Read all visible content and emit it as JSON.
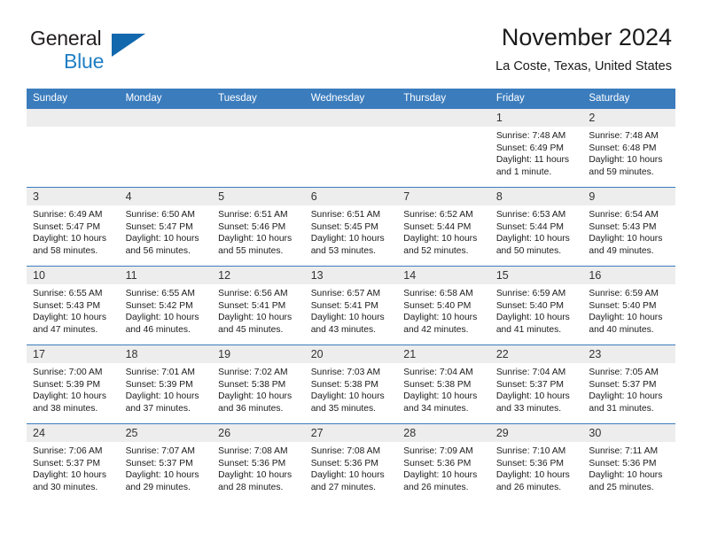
{
  "brand": {
    "name_part1": "General",
    "name_part2": "Blue",
    "logo_icon": "triangle-logo-icon"
  },
  "header": {
    "title": "November 2024",
    "location": "La Coste, Texas, United States"
  },
  "calendar": {
    "weekday_headers": [
      "Sunday",
      "Monday",
      "Tuesday",
      "Wednesday",
      "Thursday",
      "Friday",
      "Saturday"
    ],
    "colors": {
      "header_blue": "#3b7cbd",
      "daynum_gray": "#ededed",
      "brand_blue": "#1f7fc4",
      "logo_blue": "#1268ad",
      "text": "#1b1b1b"
    },
    "weeks": [
      [
        {
          "day": "",
          "sunrise": "",
          "sunset": "",
          "daylight": "",
          "daylight2": ""
        },
        {
          "day": "",
          "sunrise": "",
          "sunset": "",
          "daylight": "",
          "daylight2": ""
        },
        {
          "day": "",
          "sunrise": "",
          "sunset": "",
          "daylight": "",
          "daylight2": ""
        },
        {
          "day": "",
          "sunrise": "",
          "sunset": "",
          "daylight": "",
          "daylight2": ""
        },
        {
          "day": "",
          "sunrise": "",
          "sunset": "",
          "daylight": "",
          "daylight2": ""
        },
        {
          "day": "1",
          "sunrise": "Sunrise: 7:48 AM",
          "sunset": "Sunset: 6:49 PM",
          "daylight": "Daylight: 11 hours",
          "daylight2": "and 1 minute."
        },
        {
          "day": "2",
          "sunrise": "Sunrise: 7:48 AM",
          "sunset": "Sunset: 6:48 PM",
          "daylight": "Daylight: 10 hours",
          "daylight2": "and 59 minutes."
        }
      ],
      [
        {
          "day": "3",
          "sunrise": "Sunrise: 6:49 AM",
          "sunset": "Sunset: 5:47 PM",
          "daylight": "Daylight: 10 hours",
          "daylight2": "and 58 minutes."
        },
        {
          "day": "4",
          "sunrise": "Sunrise: 6:50 AM",
          "sunset": "Sunset: 5:47 PM",
          "daylight": "Daylight: 10 hours",
          "daylight2": "and 56 minutes."
        },
        {
          "day": "5",
          "sunrise": "Sunrise: 6:51 AM",
          "sunset": "Sunset: 5:46 PM",
          "daylight": "Daylight: 10 hours",
          "daylight2": "and 55 minutes."
        },
        {
          "day": "6",
          "sunrise": "Sunrise: 6:51 AM",
          "sunset": "Sunset: 5:45 PM",
          "daylight": "Daylight: 10 hours",
          "daylight2": "and 53 minutes."
        },
        {
          "day": "7",
          "sunrise": "Sunrise: 6:52 AM",
          "sunset": "Sunset: 5:44 PM",
          "daylight": "Daylight: 10 hours",
          "daylight2": "and 52 minutes."
        },
        {
          "day": "8",
          "sunrise": "Sunrise: 6:53 AM",
          "sunset": "Sunset: 5:44 PM",
          "daylight": "Daylight: 10 hours",
          "daylight2": "and 50 minutes."
        },
        {
          "day": "9",
          "sunrise": "Sunrise: 6:54 AM",
          "sunset": "Sunset: 5:43 PM",
          "daylight": "Daylight: 10 hours",
          "daylight2": "and 49 minutes."
        }
      ],
      [
        {
          "day": "10",
          "sunrise": "Sunrise: 6:55 AM",
          "sunset": "Sunset: 5:43 PM",
          "daylight": "Daylight: 10 hours",
          "daylight2": "and 47 minutes."
        },
        {
          "day": "11",
          "sunrise": "Sunrise: 6:55 AM",
          "sunset": "Sunset: 5:42 PM",
          "daylight": "Daylight: 10 hours",
          "daylight2": "and 46 minutes."
        },
        {
          "day": "12",
          "sunrise": "Sunrise: 6:56 AM",
          "sunset": "Sunset: 5:41 PM",
          "daylight": "Daylight: 10 hours",
          "daylight2": "and 45 minutes."
        },
        {
          "day": "13",
          "sunrise": "Sunrise: 6:57 AM",
          "sunset": "Sunset: 5:41 PM",
          "daylight": "Daylight: 10 hours",
          "daylight2": "and 43 minutes."
        },
        {
          "day": "14",
          "sunrise": "Sunrise: 6:58 AM",
          "sunset": "Sunset: 5:40 PM",
          "daylight": "Daylight: 10 hours",
          "daylight2": "and 42 minutes."
        },
        {
          "day": "15",
          "sunrise": "Sunrise: 6:59 AM",
          "sunset": "Sunset: 5:40 PM",
          "daylight": "Daylight: 10 hours",
          "daylight2": "and 41 minutes."
        },
        {
          "day": "16",
          "sunrise": "Sunrise: 6:59 AM",
          "sunset": "Sunset: 5:40 PM",
          "daylight": "Daylight: 10 hours",
          "daylight2": "and 40 minutes."
        }
      ],
      [
        {
          "day": "17",
          "sunrise": "Sunrise: 7:00 AM",
          "sunset": "Sunset: 5:39 PM",
          "daylight": "Daylight: 10 hours",
          "daylight2": "and 38 minutes."
        },
        {
          "day": "18",
          "sunrise": "Sunrise: 7:01 AM",
          "sunset": "Sunset: 5:39 PM",
          "daylight": "Daylight: 10 hours",
          "daylight2": "and 37 minutes."
        },
        {
          "day": "19",
          "sunrise": "Sunrise: 7:02 AM",
          "sunset": "Sunset: 5:38 PM",
          "daylight": "Daylight: 10 hours",
          "daylight2": "and 36 minutes."
        },
        {
          "day": "20",
          "sunrise": "Sunrise: 7:03 AM",
          "sunset": "Sunset: 5:38 PM",
          "daylight": "Daylight: 10 hours",
          "daylight2": "and 35 minutes."
        },
        {
          "day": "21",
          "sunrise": "Sunrise: 7:04 AM",
          "sunset": "Sunset: 5:38 PM",
          "daylight": "Daylight: 10 hours",
          "daylight2": "and 34 minutes."
        },
        {
          "day": "22",
          "sunrise": "Sunrise: 7:04 AM",
          "sunset": "Sunset: 5:37 PM",
          "daylight": "Daylight: 10 hours",
          "daylight2": "and 33 minutes."
        },
        {
          "day": "23",
          "sunrise": "Sunrise: 7:05 AM",
          "sunset": "Sunset: 5:37 PM",
          "daylight": "Daylight: 10 hours",
          "daylight2": "and 31 minutes."
        }
      ],
      [
        {
          "day": "24",
          "sunrise": "Sunrise: 7:06 AM",
          "sunset": "Sunset: 5:37 PM",
          "daylight": "Daylight: 10 hours",
          "daylight2": "and 30 minutes."
        },
        {
          "day": "25",
          "sunrise": "Sunrise: 7:07 AM",
          "sunset": "Sunset: 5:37 PM",
          "daylight": "Daylight: 10 hours",
          "daylight2": "and 29 minutes."
        },
        {
          "day": "26",
          "sunrise": "Sunrise: 7:08 AM",
          "sunset": "Sunset: 5:36 PM",
          "daylight": "Daylight: 10 hours",
          "daylight2": "and 28 minutes."
        },
        {
          "day": "27",
          "sunrise": "Sunrise: 7:08 AM",
          "sunset": "Sunset: 5:36 PM",
          "daylight": "Daylight: 10 hours",
          "daylight2": "and 27 minutes."
        },
        {
          "day": "28",
          "sunrise": "Sunrise: 7:09 AM",
          "sunset": "Sunset: 5:36 PM",
          "daylight": "Daylight: 10 hours",
          "daylight2": "and 26 minutes."
        },
        {
          "day": "29",
          "sunrise": "Sunrise: 7:10 AM",
          "sunset": "Sunset: 5:36 PM",
          "daylight": "Daylight: 10 hours",
          "daylight2": "and 26 minutes."
        },
        {
          "day": "30",
          "sunrise": "Sunrise: 7:11 AM",
          "sunset": "Sunset: 5:36 PM",
          "daylight": "Daylight: 10 hours",
          "daylight2": "and 25 minutes."
        }
      ]
    ]
  }
}
